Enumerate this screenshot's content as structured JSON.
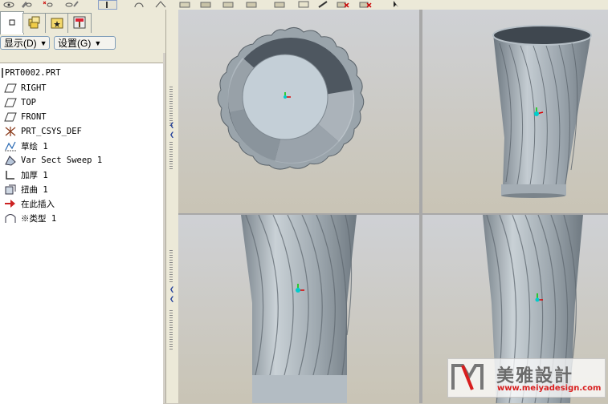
{
  "panel": {
    "tabs": [
      "model-tree-tab",
      "layer-tab",
      "favorites-tab",
      "tools-tab"
    ],
    "show_button": "显示(D)",
    "settings_button": "设置(G)"
  },
  "tree": {
    "root": "PRT0002.PRT",
    "nodes": [
      {
        "icon": "datum-plane-icon",
        "label": "RIGHT"
      },
      {
        "icon": "datum-plane-icon",
        "label": "TOP"
      },
      {
        "icon": "datum-plane-icon",
        "label": "FRONT"
      },
      {
        "icon": "coordinate-system-icon",
        "label": "PRT_CSYS_DEF"
      },
      {
        "icon": "sketch-icon",
        "label": "草绘 1"
      },
      {
        "icon": "sweep-icon",
        "label": "Var Sect Sweep 1"
      },
      {
        "icon": "thicken-icon",
        "label": "加厚 1"
      },
      {
        "icon": "warp-icon",
        "label": "扭曲 1"
      },
      {
        "icon": "insert-here-icon",
        "label": "在此插入"
      },
      {
        "icon": "shape-type-icon",
        "label": "※类型 1"
      }
    ]
  },
  "watermark": {
    "title": "美雅設計",
    "url": "www.meiyadesign.com"
  },
  "colors": {
    "panel_bg": "#ece9d8",
    "viewport_bg": "#cfd1d5",
    "model": "#8e9aa3",
    "accent_red": "#d81e1e"
  }
}
